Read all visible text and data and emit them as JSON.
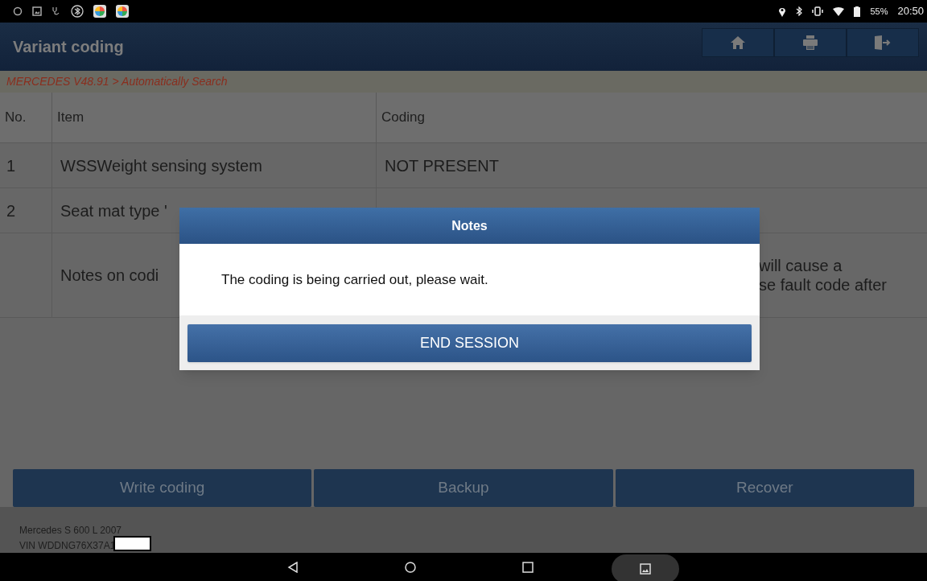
{
  "status_bar": {
    "battery": "55%",
    "time": "20:50"
  },
  "header": {
    "title": "Variant coding"
  },
  "breadcrumb": "MERCEDES V48.91 > Automatically Search",
  "table": {
    "columns": [
      "No.",
      "Item",
      "Coding"
    ],
    "rows": [
      {
        "no": "1",
        "item": "WSSWeight sensing system",
        "coding": "NOT PRESENT",
        "kind": "plain"
      },
      {
        "no": "2",
        "item": "Seat mat type '",
        "coding": "",
        "kind": "plain"
      },
      {
        "no": "",
        "item": "Notes on codi",
        "coding": "will cause a\nse fault code after",
        "kind": "tall"
      }
    ]
  },
  "actions": [
    {
      "label": "Write coding"
    },
    {
      "label": "Backup"
    },
    {
      "label": "Recover"
    }
  ],
  "vehicle": {
    "model": "Mercedes S 600 L 2007",
    "vin": "VIN WDDNG76X37A1"
  },
  "dialog": {
    "title": "Notes",
    "message": "The coding is being carried out, please wait.",
    "button": "END SESSION"
  }
}
